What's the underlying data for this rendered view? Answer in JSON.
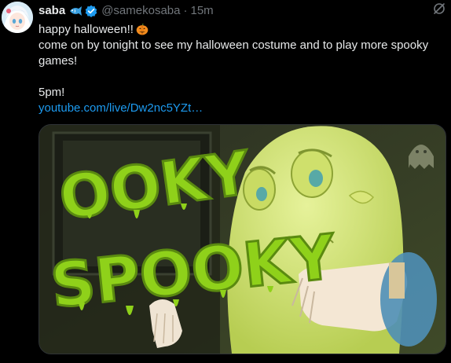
{
  "author": {
    "display_name": "saba",
    "handle": "@samekosaba",
    "separator": "·",
    "timestamp": "15m",
    "badges": [
      "fish-emoji-icon",
      "verified-badge-icon"
    ]
  },
  "tweet": {
    "line1": "happy halloween!!",
    "line1_emoji": "jack-o-lantern-icon",
    "line2": "come on by tonight to see my halloween costume and to play more spooky games!",
    "line3": "5pm!",
    "link": "youtube.com/live/Dw2nc5YZt…"
  },
  "media": {
    "headline_top": "OOKY",
    "headline_bottom": "SPOOKY",
    "colors": {
      "accent_green": "#8fd11a",
      "ghost_yellow": "#d7e87a",
      "link_blue": "#1d9bf0"
    }
  }
}
